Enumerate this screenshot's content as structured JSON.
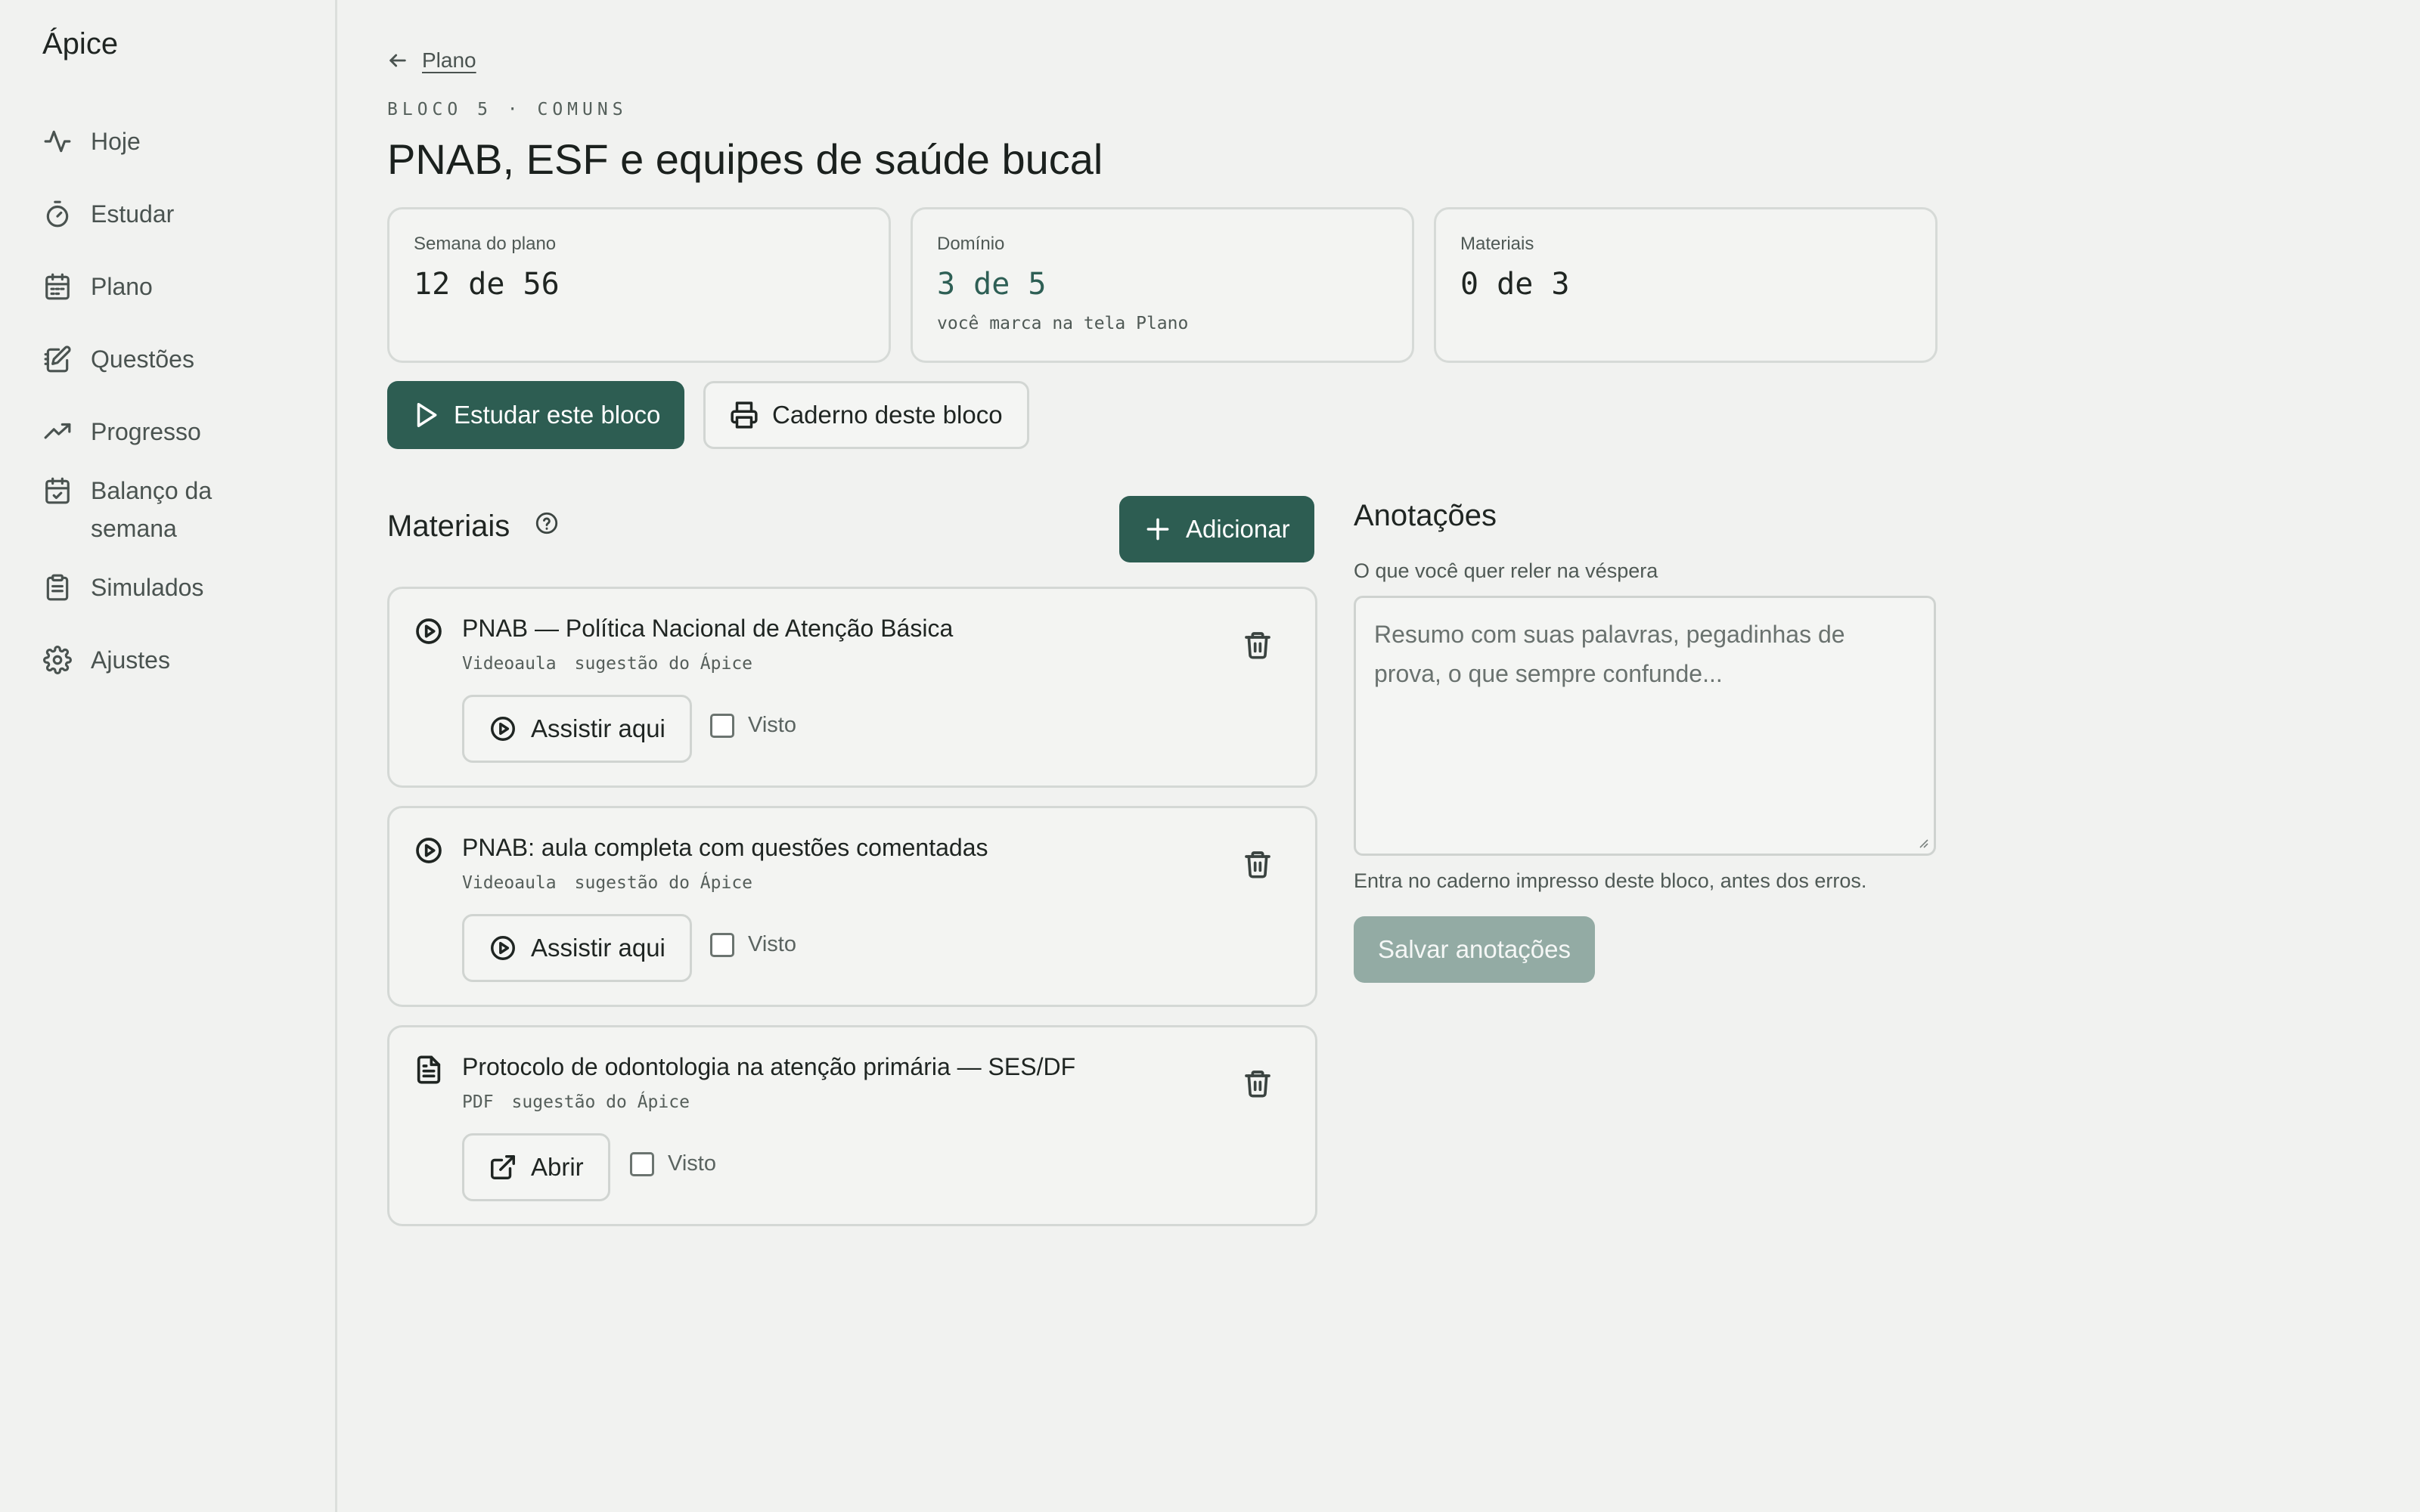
{
  "app": {
    "name": "Ápice"
  },
  "sidebar": {
    "items": [
      {
        "label": "Hoje",
        "icon": "activity-icon"
      },
      {
        "label": "Estudar",
        "icon": "timer-icon"
      },
      {
        "label": "Plano",
        "icon": "calendar-icon"
      },
      {
        "label": "Questões",
        "icon": "notebook-pen-icon"
      },
      {
        "label": "Progresso",
        "icon": "trending-up-icon"
      },
      {
        "label": "Balanço da semana",
        "icon": "calendar-check-icon"
      },
      {
        "label": "Simulados",
        "icon": "clipboard-icon"
      },
      {
        "label": "Ajustes",
        "icon": "gear-icon"
      }
    ]
  },
  "header": {
    "back_label": "Plano",
    "kicker": "BLOCO 5 · COMUNS",
    "title": "PNAB, ESF e equipes de saúde bucal"
  },
  "stats": [
    {
      "label": "Semana do plano",
      "value": "12 de 56",
      "sub": ""
    },
    {
      "label": "Domínio",
      "value": "3 de 5",
      "sub": "você marca na tela Plano"
    },
    {
      "label": "Materiais",
      "value": "0 de 3",
      "sub": ""
    }
  ],
  "actions": {
    "study_label": "Estudar este bloco",
    "notebook_label": "Caderno deste bloco"
  },
  "materials": {
    "heading": "Materiais",
    "add_label": "Adicionar",
    "items": [
      {
        "title": "PNAB — Política Nacional de Atenção Básica",
        "type": "Videoaula",
        "source": "sugestão do Ápice",
        "action_label": "Assistir aqui",
        "seen_label": "Visto",
        "seen": false
      },
      {
        "title": "PNAB: aula completa com questões comentadas",
        "type": "Videoaula",
        "source": "sugestão do Ápice",
        "action_label": "Assistir aqui",
        "seen_label": "Visto",
        "seen": false
      },
      {
        "title": "Protocolo de odontologia na atenção primária — SES/DF",
        "type": "PDF",
        "source": "sugestão do Ápice",
        "action_label": "Abrir",
        "seen_label": "Visto",
        "seen": false
      }
    ]
  },
  "notes": {
    "heading": "Anotações",
    "subtitle": "O que você quer reler na véspera",
    "placeholder": "Resumo com suas palavras, pegadinhas de prova, o que sempre confunde...",
    "value": "",
    "footnote": "Entra no caderno impresso deste bloco, antes dos erros.",
    "save_label": "Salvar anotações"
  },
  "colors": {
    "accent": "#2d5d52",
    "accent_disabled": "#93aba4",
    "background": "#f1f2f0"
  }
}
